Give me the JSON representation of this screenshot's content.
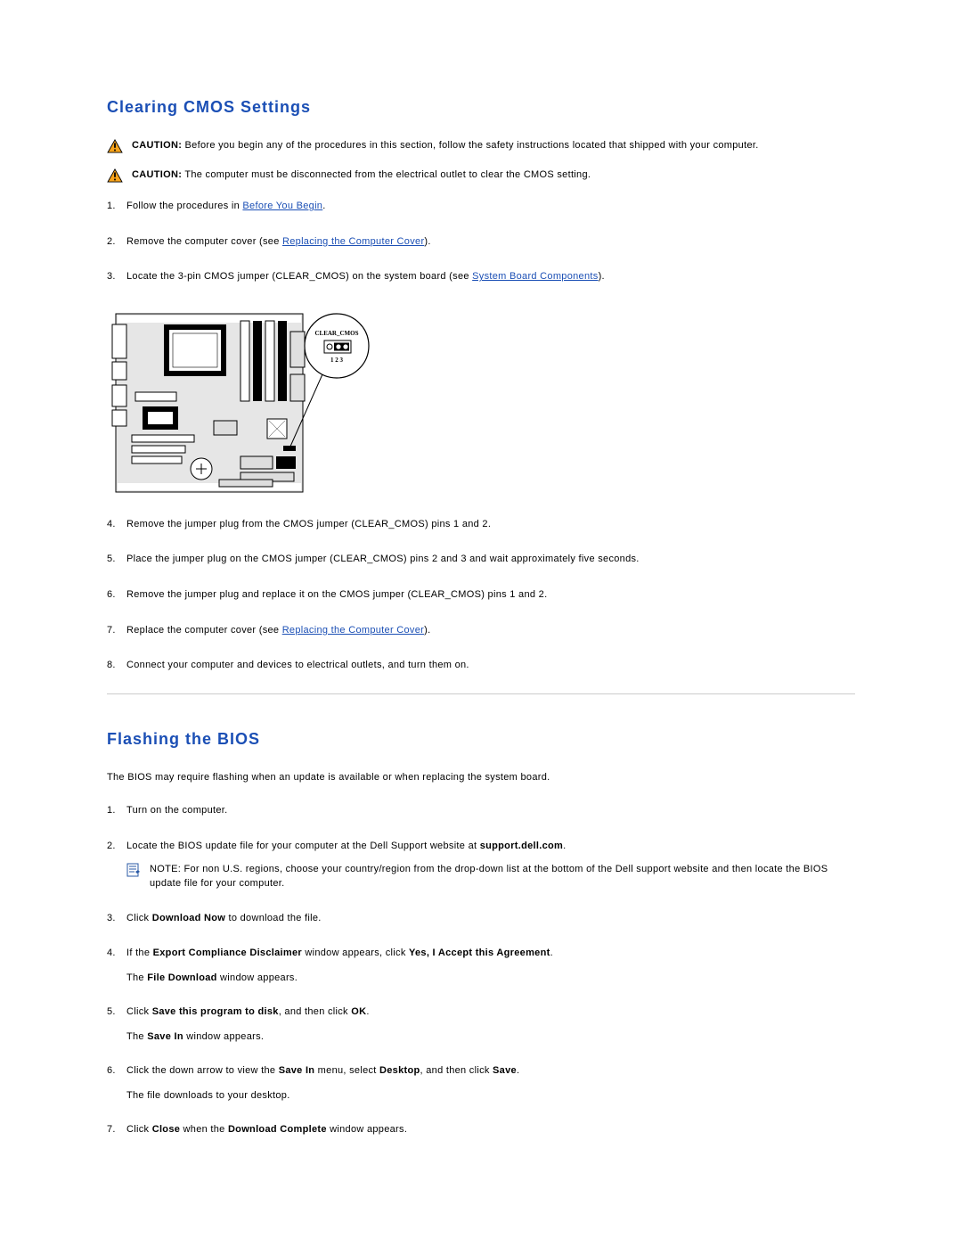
{
  "section1": {
    "heading": "Clearing CMOS Settings",
    "caution1_label": "CAUTION:",
    "caution1_text": " Before you begin any of the procedures in this section, follow the safety instructions located that shipped with your computer.",
    "caution2_label": "CAUTION:",
    "caution2_text": " The computer must be disconnected from the electrical outlet to clear the CMOS setting.",
    "step1_a": "Follow the procedures in ",
    "step1_link": "Before You Begin",
    "step1_b": ".",
    "step2_a": "Remove the computer cover (see ",
    "step2_link": "Replacing the Computer Cover",
    "step2_b": ").",
    "step3_a": "Locate the 3-pin CMOS jumper (CLEAR_CMOS) on the system board (see ",
    "step3_link": "System Board Components",
    "step3_b": ").",
    "step4": "Remove the jumper plug from the CMOS jumper (CLEAR_CMOS) pins 1 and 2.",
    "step5": "Place the jumper plug on the CMOS jumper (CLEAR_CMOS) pins 2 and 3 and wait approximately five seconds.",
    "step6": "Remove the jumper plug and replace it on the CMOS jumper (CLEAR_CMOS) pins 1 and 2.",
    "step7_a": "Replace the computer cover (see ",
    "step7_link": "Replacing the Computer Cover",
    "step7_b": ").",
    "step8": "Connect your computer and devices to electrical outlets, and turn them on.",
    "callout_label": "CLEAR_CMOS",
    "callout_pins": "1 2 3"
  },
  "section2": {
    "heading": "Flashing the BIOS",
    "intro": "The BIOS may require flashing when an update is available or when replacing the system board.",
    "step1": "Turn on the computer.",
    "step2_a": "Locate the BIOS update file for your computer at the Dell Support website at ",
    "step2_site": "support.dell.com",
    "step2_b": ".",
    "note_label": "NOTE:",
    "note_text": " For non U.S. regions, choose your country/region from the drop-down list at the bottom of the Dell support website and then locate the BIOS update file for your computer.",
    "step3_a": "Click ",
    "step3_bold": "Download Now",
    "step3_b": " to download the file.",
    "step4_a": "If the ",
    "step4_bold1": "Export Compliance Disclaimer",
    "step4_mid": " window appears, click ",
    "step4_bold2": "Yes, I Accept this Agreement",
    "step4_b": ".",
    "step4_sub_a": "The ",
    "step4_sub_bold": "File Download",
    "step4_sub_b": " window appears.",
    "step5_a": "Click ",
    "step5_bold1": "Save this program to disk",
    "step5_mid": ", and then click ",
    "step5_bold2": "OK",
    "step5_b": ".",
    "step5_sub_a": "The ",
    "step5_sub_bold": "Save In",
    "step5_sub_b": " window appears.",
    "step6_a": "Click the down arrow to view the ",
    "step6_bold1": "Save In",
    "step6_mid": " menu, select ",
    "step6_bold2": "Desktop",
    "step6_mid2": ", and then click ",
    "step6_bold3": "Save",
    "step6_b": ".",
    "step6_sub": "The file downloads to your desktop.",
    "step7_a": "Click ",
    "step7_bold1": "Close",
    "step7_mid": " when the ",
    "step7_bold2": "Download Complete",
    "step7_b": " window appears."
  }
}
